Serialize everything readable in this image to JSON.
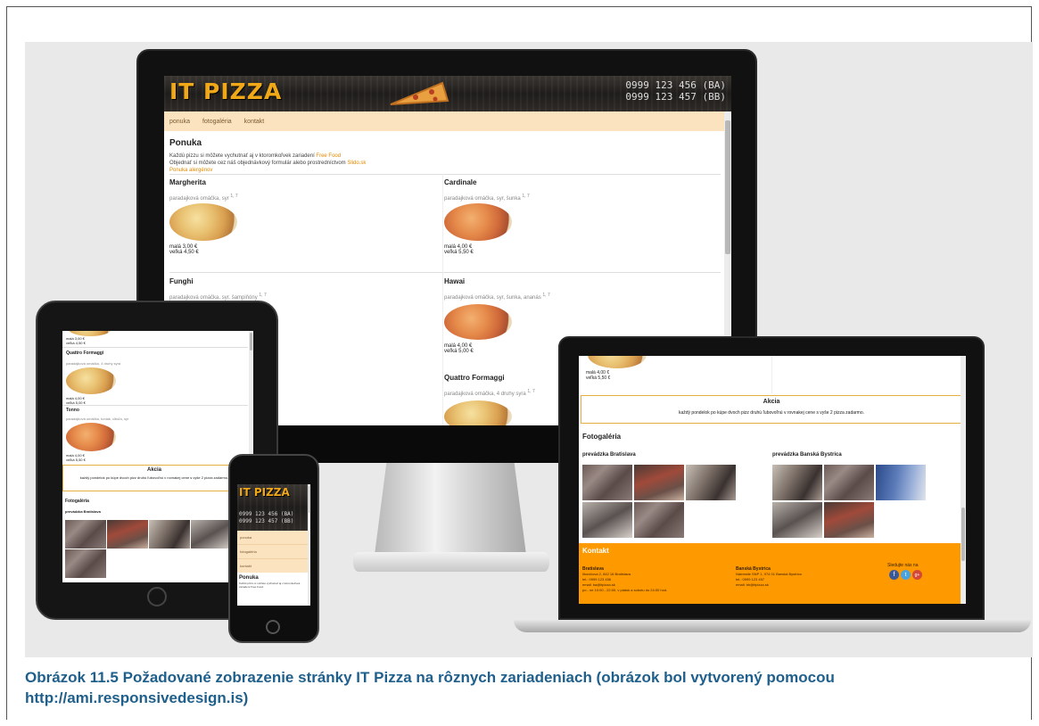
{
  "site": {
    "logo": "IT PIZZA",
    "phone_ba": "0999 123 456 (BA)",
    "phone_bb": "0999 123 457 (BB)",
    "nav": [
      "ponuka",
      "fotogaléria",
      "kontakt"
    ],
    "section_title": "Ponuka",
    "intro_line1": "Každú pizzu si môžete vychutnať aj v ktoromkoľvek zariadení ",
    "intro_link1": "Free Food",
    "intro_line2": "Objednať si môžete cez náš objednávkový formulár alebo prostredníctvom ",
    "intro_link2": "Slido.sk",
    "intro_link3": "Ponuka alergénov"
  },
  "menu": [
    {
      "name": "Margherita",
      "desc": "paradajková omáčka, syr",
      "allergens": "1, 7",
      "small": "malá 3,00 €",
      "large": "veľká 4,50 €",
      "tomato": false
    },
    {
      "name": "Cardinale",
      "desc": "paradajková omáčka, syr, šunka",
      "allergens": "1, 7",
      "small": "malá 4,00 €",
      "large": "veľká 5,50 €",
      "tomato": true
    },
    {
      "name": "Funghi",
      "desc": "paradajková omáčka, syr, šampiňóny",
      "allergens": "1, 7",
      "small": "",
      "large": "",
      "tomato": false
    },
    {
      "name": "Hawai",
      "desc": "paradajková omáčka, syr, šunka, ananás",
      "allergens": "1, 7",
      "small": "malá 4,00 €",
      "large": "veľká 5,00 €",
      "tomato": true
    },
    {
      "name": "Quattro Formaggi",
      "desc": "paradajková omáčka, 4 druhy syra",
      "allergens": "1, 7",
      "small": "",
      "large": "",
      "tomato": false
    }
  ],
  "promo": {
    "title": "Akcia",
    "text": "každý pondelok po kúpe dvoch pizz druhú ľubovoľnú v rovnakej cene s vyše 2 pizza zadarmo."
  },
  "gallery": {
    "title": "Fotogaléria",
    "branch_ba": "prevádzka Bratislava",
    "branch_bb": "prevádzka Banská Bystrica"
  },
  "contact": {
    "title": "Kontakt",
    "ba_title": "Bratislava",
    "ba_lines": [
      "Ilkovičova 2, 842 16 Bratislava",
      "tel.: 0999 123 456",
      "email: ba@itpizza.sk",
      "po - ne 10:00 - 22:00, v piatok a sobotu do 24:00 hod."
    ],
    "bb_title": "Banská Bystrica",
    "bb_lines": [
      "Námestie SNP 1, 974 01 Banská Bystrica",
      "tel.: 0999 123 457",
      "email: bb@itpizza.sk"
    ],
    "follow": "Sledujte nás na"
  },
  "laptop_partial": {
    "prices": [
      "malá 4,00 €",
      "veľká 5,50 €"
    ]
  },
  "tablet": {
    "partial_prices": [
      "malá 3,00 €",
      "veľká 4,50 €"
    ],
    "item1_name": "Quattro Formaggi",
    "item1_desc": "paradajková omáčka, 4 druhy syra",
    "item1_prices": [
      "malá 4,00 €",
      "veľká 5,00 €"
    ],
    "item2_name": "Tonno",
    "item2_desc": "paradajková omáčka, tuniak, cibuľa, syr",
    "item2_prices": [
      "malá 4,00 €",
      "veľká 5,50 €"
    ]
  },
  "phone": {
    "nav": [
      "ponuka",
      "fotogaléria",
      "kontakt"
    ],
    "section_title": "Ponuka",
    "intro": "Každú pizzu si môžete vychutnať aj v ktoromkoľvek zariadení Free Food."
  },
  "caption": {
    "line": "Obrázok 11.5 Požadované zobrazenie stránky IT Pizza na rôznych zariadeniach (obrázok bol vytvorený pomocou http://ami.responsivedesign.is)"
  },
  "colors": {
    "accent": "#f0a818",
    "contact_bg": "#ff9900",
    "nav_bg": "#fce3c0",
    "caption": "#1f5f8b"
  },
  "icons": [
    "facebook-icon",
    "twitter-icon",
    "google-plus-icon"
  ]
}
